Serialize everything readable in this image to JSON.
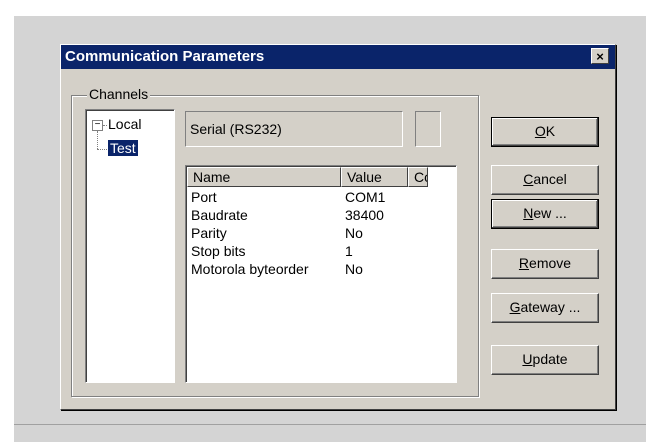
{
  "window": {
    "title": "Communication Parameters",
    "close_label": "×"
  },
  "channels": {
    "group_label": "Channels",
    "tree": [
      {
        "label": "Local",
        "expander": "−"
      },
      {
        "label": "Test",
        "selected": true
      }
    ]
  },
  "protocol": {
    "label": "Serial (RS232)"
  },
  "table": {
    "headers": [
      "Name",
      "Value",
      "Co"
    ],
    "rows": [
      {
        "name": "Port",
        "value": "COM1"
      },
      {
        "name": "Baudrate",
        "value": "38400"
      },
      {
        "name": "Parity",
        "value": "No"
      },
      {
        "name": "Stop bits",
        "value": "1"
      },
      {
        "name": "Motorola byteorder",
        "value": "No"
      }
    ]
  },
  "buttons": {
    "ok": {
      "u": "O",
      "rest": "K"
    },
    "cancel": {
      "u": "C",
      "rest": "ancel"
    },
    "new": {
      "u": "N",
      "rest": "ew ..."
    },
    "remove": {
      "u": "R",
      "rest": "emove"
    },
    "gateway": {
      "u": "G",
      "rest": "ateway ..."
    },
    "update": {
      "u": "U",
      "rest": "pdate"
    }
  },
  "colors": {
    "titlebar": "#0a246a",
    "dialog_bg": "#d4d0c8",
    "selection": "#0a246a"
  }
}
